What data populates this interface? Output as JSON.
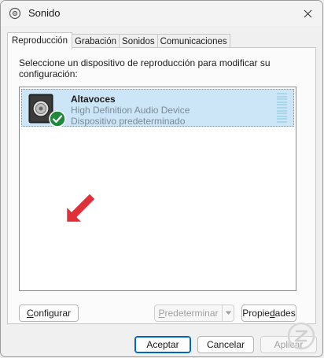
{
  "window": {
    "title": "Sonido",
    "close_glyph": "✕"
  },
  "tabs": [
    {
      "label": "Reproducción",
      "active": true
    },
    {
      "label": "Grabación",
      "active": false
    },
    {
      "label": "Sonidos",
      "active": false
    },
    {
      "label": "Comunicaciones",
      "active": false
    }
  ],
  "panel": {
    "instruction": "Seleccione un dispositivo de reproducción para modificar su configuración:"
  },
  "devices": [
    {
      "name": "Altavoces",
      "description": "High Definition Audio Device",
      "status": "Dispositivo predeterminado",
      "icon": "speaker-icon",
      "badge": "default-check-icon",
      "selected": true
    }
  ],
  "buttons": {
    "configure": {
      "prefix": "",
      "accel": "C",
      "rest": "onfigurar"
    },
    "set_default": {
      "prefix": "",
      "accel": "P",
      "rest": "redeterminar",
      "enabled": false
    },
    "properties": {
      "prefix": "Propie",
      "accel": "d",
      "rest": "ades"
    },
    "accept": "Aceptar",
    "cancel": "Cancelar",
    "apply": "Aplicar"
  },
  "colors": {
    "selection": "#cde6f7",
    "accent": "#0067c0",
    "check_badge": "#1f8a3c",
    "annotation_arrow": "#e0313b"
  }
}
